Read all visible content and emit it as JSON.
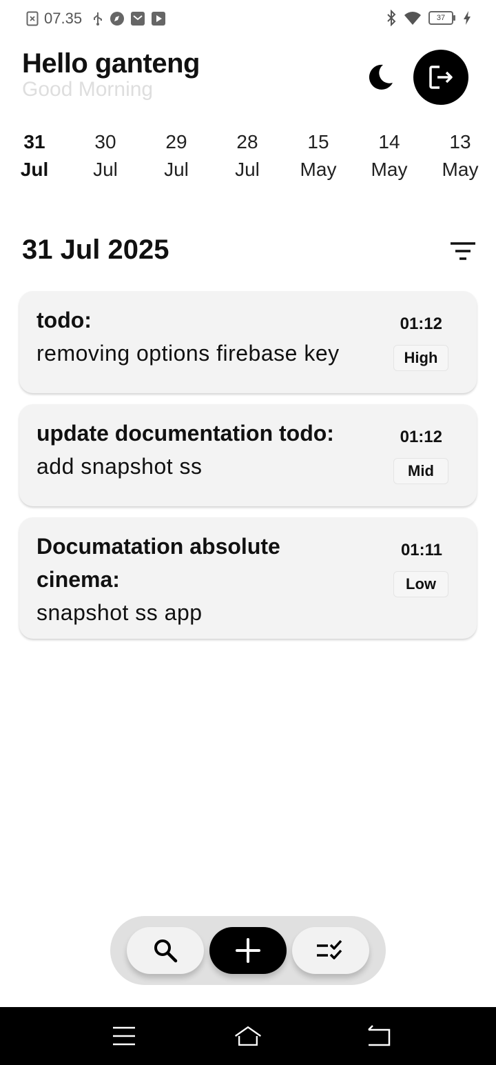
{
  "status_bar": {
    "time": "07.35",
    "battery": "37",
    "icons_left": [
      "screenshot-icon",
      "usb-icon",
      "compass-icon",
      "mail-icon",
      "youtube-icon"
    ],
    "icons_right": [
      "bluetooth-icon",
      "wifi-icon",
      "battery-icon",
      "charging-icon"
    ]
  },
  "header": {
    "title": "Hello ganteng",
    "subtitle": "Good Morning",
    "theme_icon": "moon-icon",
    "logout_icon": "logout-icon"
  },
  "date_strip": [
    {
      "day": "31",
      "month": "Jul",
      "active": true
    },
    {
      "day": "30",
      "month": "Jul",
      "active": false
    },
    {
      "day": "29",
      "month": "Jul",
      "active": false
    },
    {
      "day": "28",
      "month": "Jul",
      "active": false
    },
    {
      "day": "15",
      "month": "May",
      "active": false
    },
    {
      "day": "14",
      "month": "May",
      "active": false
    },
    {
      "day": "13",
      "month": "May",
      "active": false
    }
  ],
  "section": {
    "title": "31 Jul 2025",
    "filter_icon": "filter-icon"
  },
  "tasks": [
    {
      "title": "todo:",
      "body": "removing options firebase key",
      "time": "01:12",
      "priority": "High"
    },
    {
      "title": "update documentation todo:",
      "body": "add snapshot ss",
      "time": "01:12",
      "priority": "Mid"
    },
    {
      "title": "Documatation absolute cinema:",
      "body": "snapshot ss app",
      "time": "01:11",
      "priority": "Low"
    }
  ],
  "action_bar": {
    "search_icon": "search-icon",
    "add_icon": "plus-icon",
    "tasks_icon": "checklist-icon"
  },
  "nav_bar": {
    "icons": [
      "menu-icon",
      "home-icon",
      "back-icon"
    ]
  },
  "colors": {
    "accent": "#000000",
    "card": "#f3f3f3",
    "subtitle": "#dedede",
    "action_bar": "#e0e0e0"
  }
}
